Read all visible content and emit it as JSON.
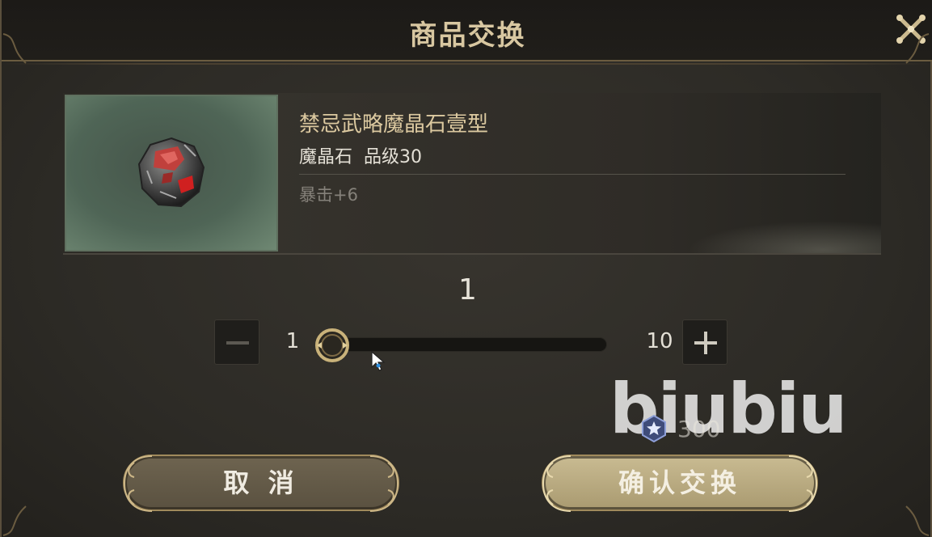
{
  "dialog": {
    "title": "商品交换",
    "close_icon": "close-x-icon"
  },
  "item": {
    "name": "禁忌武略魔晶石壹型",
    "type_line": "魔晶石  品级30",
    "stat": "暴击+6",
    "image_icon": "magic-crystal-stone-icon"
  },
  "quantity": {
    "current": "1",
    "min": "1",
    "max": "10",
    "slider_fraction": 0.0
  },
  "cost": {
    "icon": "star-gem-currency-icon",
    "value": "300"
  },
  "buttons": {
    "cancel": "取 消",
    "confirm": "确认交换"
  },
  "watermark": "biubiu",
  "colors": {
    "title": "#d8c7a1",
    "item_name": "#dcc9a0",
    "confirm_button": "#c9bb92",
    "cancel_button": "#6e6450"
  }
}
